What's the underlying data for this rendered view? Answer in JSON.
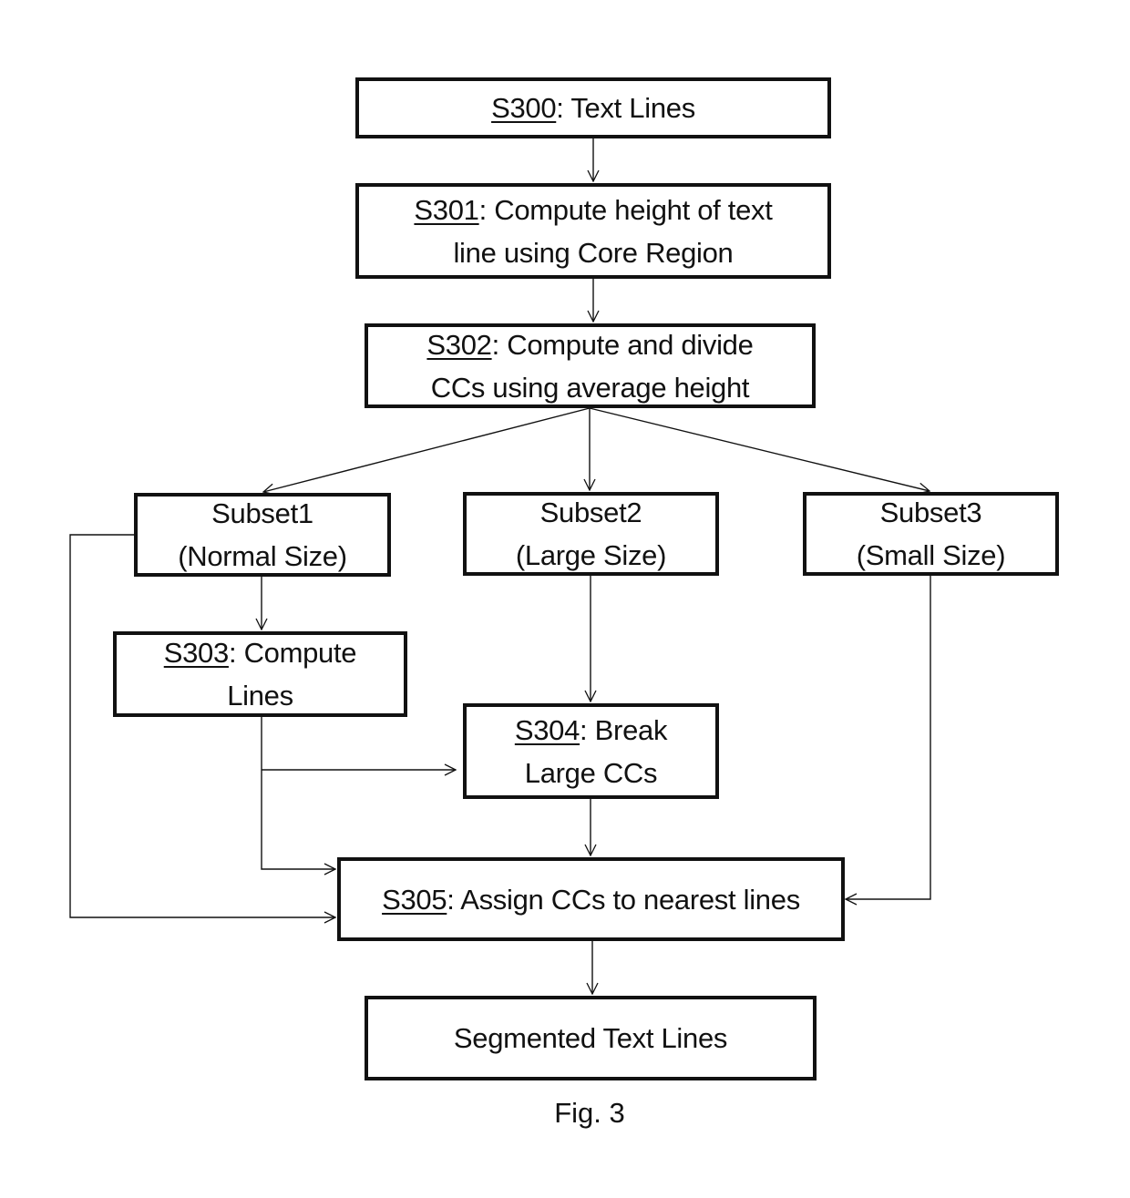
{
  "diagram": {
    "nodes": {
      "s300": {
        "step": "S300",
        "lines": [
          ": Text Lines"
        ]
      },
      "s301": {
        "step": "S301",
        "lines": [
          ": Compute height of text",
          "line using Core Region"
        ]
      },
      "s302": {
        "step": "S302",
        "lines": [
          ": Compute and divide",
          "CCs using average height"
        ]
      },
      "subset1": {
        "step": "",
        "lines": [
          "Subset1",
          "(Normal Size)"
        ]
      },
      "subset2": {
        "step": "",
        "lines": [
          "Subset2",
          "(Large Size)"
        ]
      },
      "subset3": {
        "step": "",
        "lines": [
          "Subset3",
          "(Small Size)"
        ]
      },
      "s303": {
        "step": "S303",
        "lines": [
          ": Compute",
          "Lines"
        ]
      },
      "s304": {
        "step": "S304",
        "lines": [
          ": Break",
          "Large CCs"
        ]
      },
      "s305": {
        "step": "S305",
        "lines": [
          ": Assign CCs to nearest lines"
        ]
      },
      "output": {
        "step": "",
        "lines": [
          "Segmented Text Lines"
        ]
      }
    },
    "edges": [
      {
        "from": "s300",
        "to": "s301"
      },
      {
        "from": "s301",
        "to": "s302"
      },
      {
        "from": "s302",
        "to": "subset1"
      },
      {
        "from": "s302",
        "to": "subset2"
      },
      {
        "from": "s302",
        "to": "subset3"
      },
      {
        "from": "subset1",
        "to": "s303"
      },
      {
        "from": "subset1",
        "to": "s305"
      },
      {
        "from": "subset2",
        "to": "s304"
      },
      {
        "from": "subset3",
        "to": "s305"
      },
      {
        "from": "s303",
        "to": "s304"
      },
      {
        "from": "s303",
        "to": "s305"
      },
      {
        "from": "s304",
        "to": "s305"
      },
      {
        "from": "s305",
        "to": "output"
      }
    ],
    "caption": "Fig. 3"
  }
}
